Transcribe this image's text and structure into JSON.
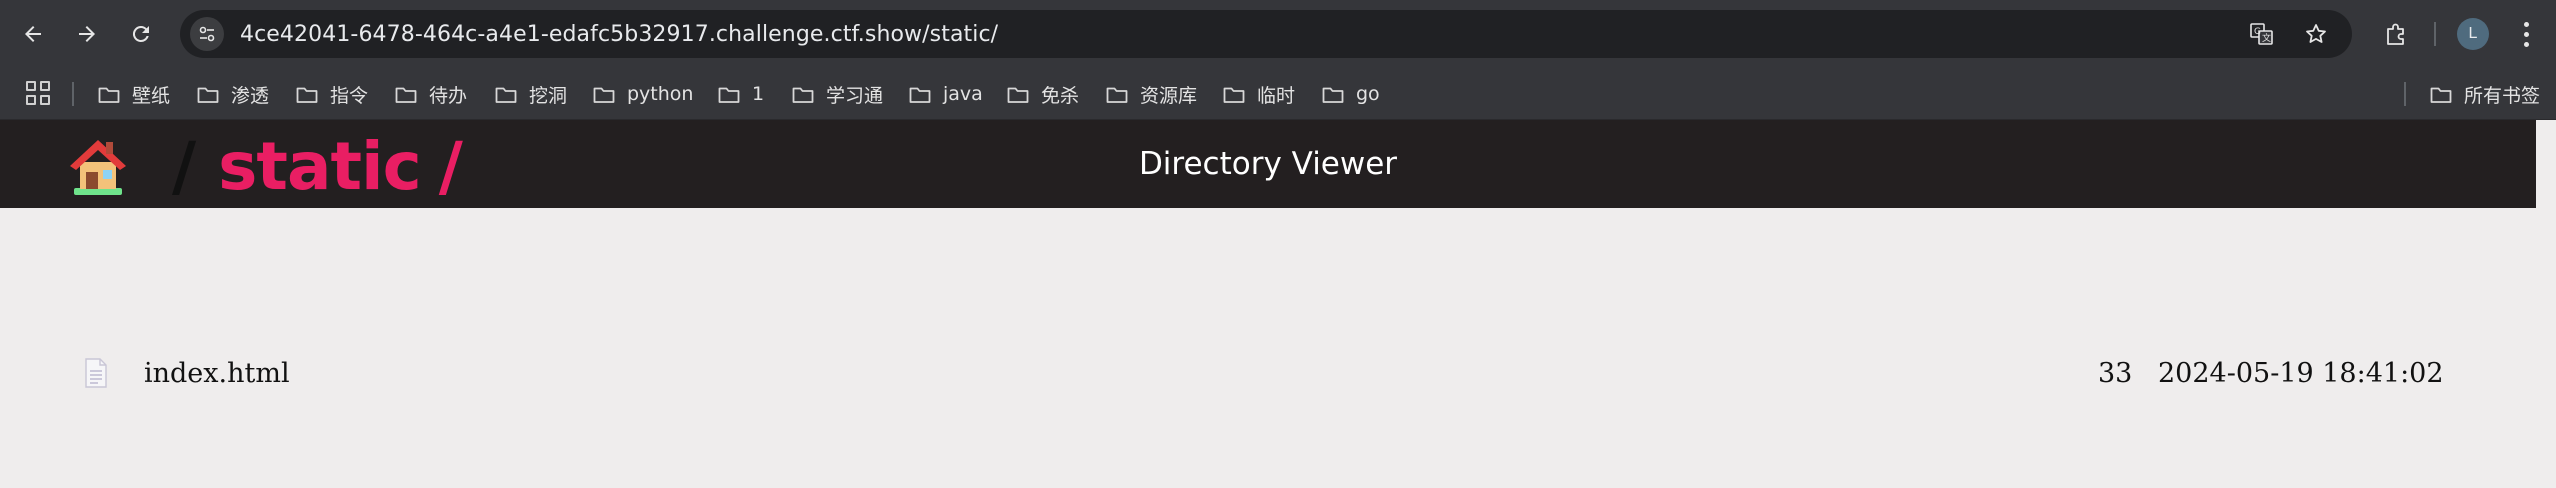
{
  "browser": {
    "url": "4ce42041-6478-464c-a4e1-edafc5b32917.challenge.ctf.show/static/",
    "profile_initial": "L",
    "icons": {
      "back": "arrow-left-icon",
      "forward": "arrow-right-icon",
      "reload": "reload-icon",
      "site_info": "tune-icon",
      "translate": "translate-icon",
      "bookmark": "star-icon",
      "extensions": "puzzle-icon",
      "menu": "kebab-menu-icon"
    }
  },
  "bookmarks": {
    "items": [
      {
        "label": "壁纸"
      },
      {
        "label": "渗透"
      },
      {
        "label": "指令"
      },
      {
        "label": "待办"
      },
      {
        "label": "挖洞"
      },
      {
        "label": "python"
      },
      {
        "label": "1"
      },
      {
        "label": "学习通"
      },
      {
        "label": "java"
      },
      {
        "label": "免杀"
      },
      {
        "label": "资源库"
      },
      {
        "label": "临时"
      },
      {
        "label": "go"
      }
    ],
    "all_bookmarks_label": "所有书签"
  },
  "page": {
    "header_title": "Directory Viewer",
    "breadcrumb": {
      "slash1": "/",
      "dir": "static",
      "slash2": "/"
    },
    "files": [
      {
        "name": "index.html",
        "size": "33",
        "modified": "2024-05-19 18:41:02"
      }
    ]
  },
  "colors": {
    "chrome_bg": "#35363a",
    "omnibox_bg": "#202124",
    "header_bg": "#231f20",
    "accent_pink": "#e91e63",
    "page_bg": "#efeded"
  }
}
